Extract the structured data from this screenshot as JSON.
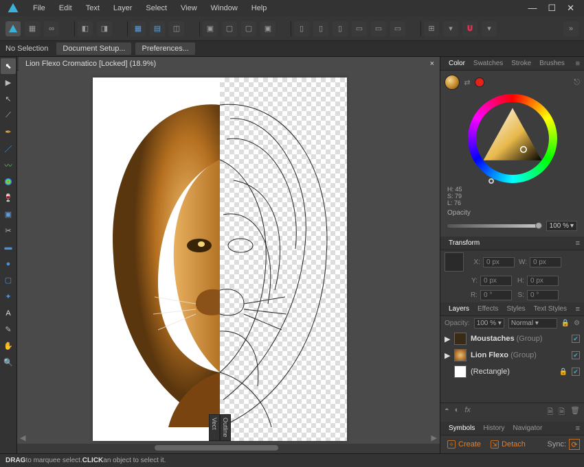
{
  "app": {
    "menus": [
      "File",
      "Edit",
      "Text",
      "Layer",
      "Select",
      "View",
      "Window",
      "Help"
    ]
  },
  "context_bar": {
    "no_selection": "No Selection",
    "doc_setup": "Document Setup...",
    "preferences": "Preferences..."
  },
  "document": {
    "tab_label": "Lion Flexo Cromatico [Locked] (18.9%)",
    "split_left": "Vect",
    "split_right": "Outline"
  },
  "panels": {
    "color": {
      "tabs": [
        "Color",
        "Swatches",
        "Stroke",
        "Brushes"
      ],
      "active_tab": "Color",
      "hsl": {
        "h_label": "H:",
        "h": "45",
        "s_label": "S:",
        "s": "79",
        "l_label": "L:",
        "l": "76"
      },
      "opacity_label": "Opacity",
      "opacity_value": "100 %",
      "fill_hex": "#d49a2e",
      "secondary_hex": "#e5231b"
    },
    "transform": {
      "tabs": [
        "Transform"
      ],
      "x_label": "X:",
      "x": "0 px",
      "y_label": "Y:",
      "y": "0 px",
      "w_label": "W:",
      "w": "0 px",
      "h_label": "H:",
      "h": "0 px",
      "r_label": "R:",
      "r": "0 °",
      "s_label": "S:",
      "s": "0 °"
    },
    "layers": {
      "tabs": [
        "Layers",
        "Effects",
        "Styles",
        "Text Styles"
      ],
      "active_tab": "Layers",
      "opacity_label": "Opacity:",
      "opacity_value": "100 %",
      "blend_value": "Normal",
      "items": [
        {
          "name": "Moustaches",
          "type": "(Group)",
          "thumb": "#3b2a18",
          "locked": false
        },
        {
          "name": "Lion Flexo",
          "type": "(Group)",
          "thumb": "#c98334",
          "locked": false
        },
        {
          "name": "(Rectangle)",
          "type": "",
          "thumb": "#ffffff",
          "locked": true
        }
      ]
    },
    "symbols": {
      "tabs": [
        "Symbols",
        "History",
        "Navigator"
      ],
      "active_tab": "Symbols",
      "create": "Create",
      "detach": "Detach",
      "sync_label": "Sync:"
    }
  },
  "statusbar": {
    "drag": "DRAG",
    "drag_text": " to marquee select. ",
    "click": "CLICK",
    "click_text": " an object to select it."
  },
  "tools": [
    "move-tool",
    "artistic-text-tool",
    "node-tool",
    "pen-tool",
    "brush-tool",
    "pencil-tool",
    "gradient-tool",
    "transparency-tool",
    "place-image-tool",
    "crop-tool",
    "shape-rect-tool",
    "shape-ellipse-tool",
    "shape-rounded-tool",
    "shapes-tool",
    "text-frame-tool",
    "color-picker-tool",
    "pan-tool",
    "zoom-tool"
  ]
}
